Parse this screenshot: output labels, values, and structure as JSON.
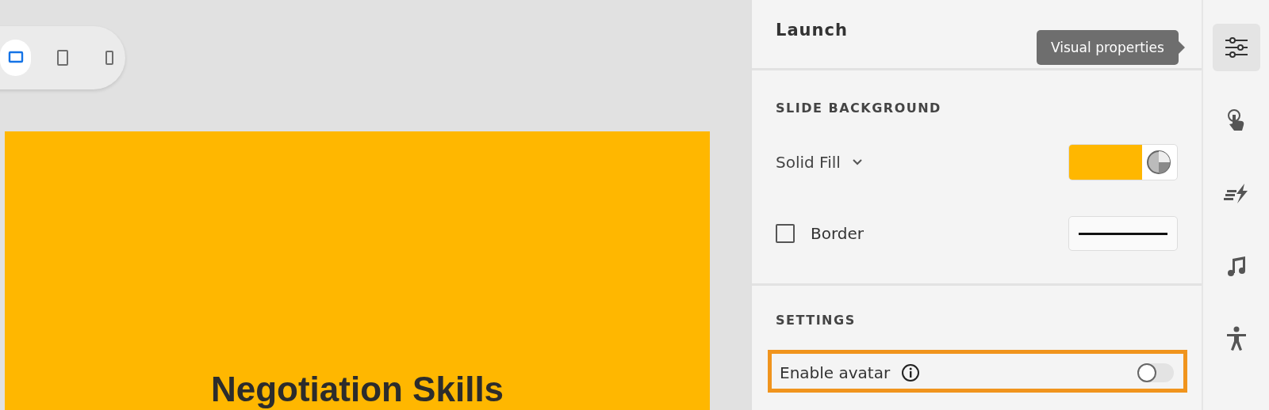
{
  "device_toolbar": [
    {
      "kind": "desktop",
      "selected": true
    },
    {
      "kind": "tablet",
      "selected": false
    },
    {
      "kind": "phone",
      "selected": false
    }
  ],
  "slide": {
    "title": "Negotiation Skills"
  },
  "panel": {
    "title": "Launch",
    "slide_background": {
      "heading": "SLIDE BACKGROUND",
      "fill_type": "Solid Fill",
      "border_label": "Border",
      "border_checked": false
    },
    "settings": {
      "heading": "SETTINGS",
      "avatar_label": "Enable avatar",
      "avatar_on": false,
      "highlighted": true
    }
  },
  "tooltip": "Visual properties",
  "rail": [
    {
      "kind": "sliders",
      "selected": true
    },
    {
      "kind": "touch",
      "selected": false
    },
    {
      "kind": "motion",
      "selected": false
    },
    {
      "kind": "music",
      "selected": false
    },
    {
      "kind": "accessibility",
      "selected": false
    }
  ]
}
